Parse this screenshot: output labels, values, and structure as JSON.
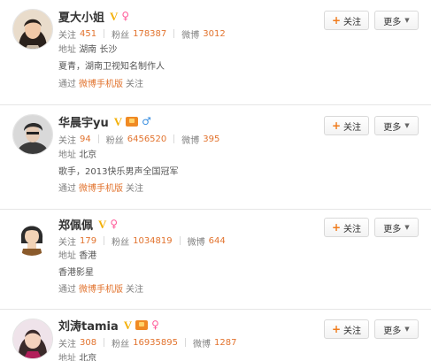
{
  "users": [
    {
      "name": "夏大小姐",
      "gender_icon": "female-icon",
      "has_level_badge": false,
      "stats": {
        "following_label": "关注",
        "following": "451",
        "fans_label": "粉丝",
        "fans": "178387",
        "weibo_label": "微博",
        "weibo": "3012"
      },
      "location_label": "地址",
      "location": "湖南 长沙",
      "bio": "夏青，湖南卫视知名制作人",
      "via_prefix": "通过",
      "via_link": "微博手机版",
      "via_suffix": "关注"
    },
    {
      "name": "华晨宇yu",
      "gender_icon": "male-icon",
      "has_level_badge": true,
      "stats": {
        "following_label": "关注",
        "following": "94",
        "fans_label": "粉丝",
        "fans": "6456520",
        "weibo_label": "微博",
        "weibo": "395"
      },
      "location_label": "地址",
      "location": "北京",
      "bio": "歌手，2013快乐男声全国冠军",
      "via_prefix": "通过",
      "via_link": "微博手机版",
      "via_suffix": "关注"
    },
    {
      "name": "郑佩佩",
      "gender_icon": "female-icon",
      "has_level_badge": false,
      "stats": {
        "following_label": "关注",
        "following": "179",
        "fans_label": "粉丝",
        "fans": "1034819",
        "weibo_label": "微博",
        "weibo": "644"
      },
      "location_label": "地址",
      "location": "香港",
      "bio": "香港影星",
      "via_prefix": "通过",
      "via_link": "微博手机版",
      "via_suffix": "关注"
    },
    {
      "name": "刘涛tamia",
      "gender_icon": "female-icon",
      "has_level_badge": true,
      "stats": {
        "following_label": "关注",
        "following": "308",
        "fans_label": "粉丝",
        "fans": "16935895",
        "weibo_label": "微博",
        "weibo": "1287"
      },
      "location_label": "地址",
      "location": "北京"
    }
  ],
  "buttons": {
    "follow_label": "关注",
    "more_label": "更多"
  },
  "colors": {
    "accent_orange": "#e2732e",
    "verified_gold": "#f3b10b",
    "female_pink": "#ff5a99",
    "male_blue": "#3a8fe0"
  }
}
